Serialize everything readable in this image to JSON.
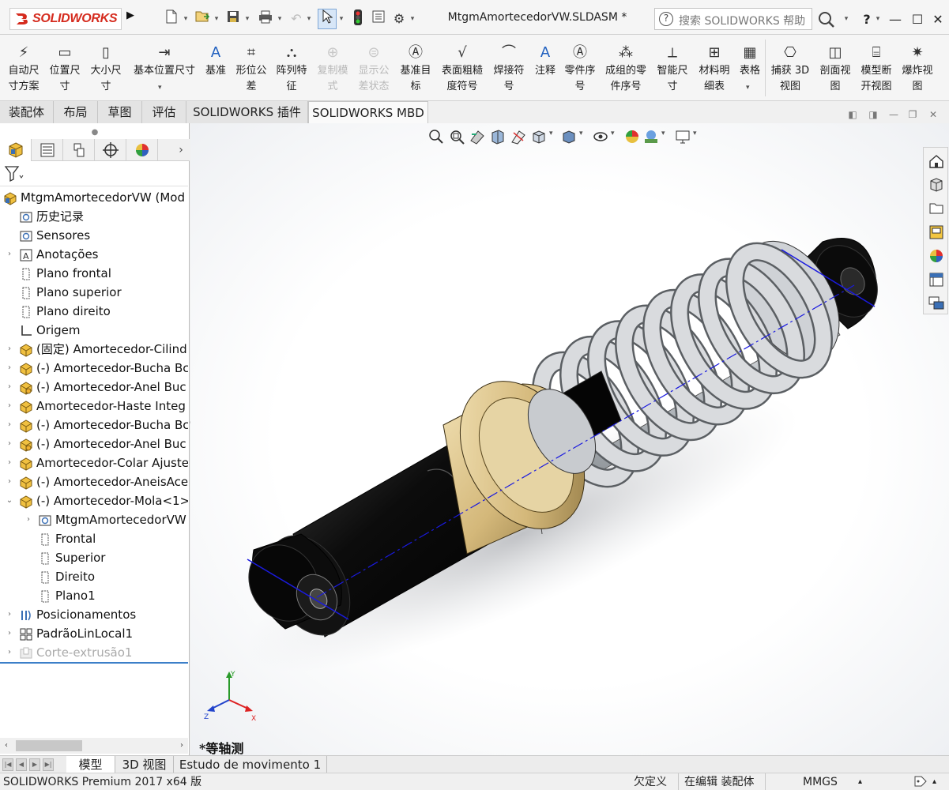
{
  "app": {
    "brand": "SOLIDWORKS",
    "document_title": "MtgmAmortecedorVW.SLDASM *",
    "help_search_placeholder": "搜索 SOLIDWORKS 帮助",
    "help_label": "?"
  },
  "ribbon": {
    "buttons": [
      {
        "label": "自动尺\n寸方案",
        "icon": "auto-dimension-icon"
      },
      {
        "label": "位置尺\n寸",
        "icon": "location-dimension-icon"
      },
      {
        "label": "大小尺\n寸",
        "icon": "size-dimension-icon"
      },
      {
        "label": "基本位置尺寸",
        "icon": "basic-location-dimension-icon"
      },
      {
        "label": "基准",
        "icon": "datum-icon"
      },
      {
        "label": "形位公\n差",
        "icon": "geometric-tolerance-icon"
      },
      {
        "label": "阵列特\n征",
        "icon": "pattern-feature-icon"
      },
      {
        "label": "复制模\n式",
        "icon": "copy-scheme-icon",
        "disabled": true
      },
      {
        "label": "显示公\n差状态",
        "icon": "show-tolerance-status-icon",
        "disabled": true
      },
      {
        "label": "基准目\n标",
        "icon": "datum-target-icon"
      },
      {
        "label": "表面粗糙\n度符号",
        "icon": "surface-finish-icon"
      },
      {
        "label": "焊接符\n号",
        "icon": "weld-symbol-icon"
      },
      {
        "label": "注释",
        "icon": "note-icon"
      },
      {
        "label": "零件序\n号",
        "icon": "balloon-icon"
      },
      {
        "label": "成组的零\n件序号",
        "icon": "stacked-balloon-icon"
      },
      {
        "label": "智能尺\n寸",
        "icon": "smart-dimension-icon"
      },
      {
        "label": "材料明\n细表",
        "icon": "bill-of-materials-icon"
      },
      {
        "label": "表格",
        "icon": "table-icon"
      },
      {
        "label": "捕获 3D\n视图",
        "icon": "capture-3d-view-icon"
      },
      {
        "label": "剖面视\n图",
        "icon": "section-view-icon"
      },
      {
        "label": "模型断\n开视图",
        "icon": "model-break-view-icon"
      },
      {
        "label": "爆炸视\n图",
        "icon": "exploded-view-icon"
      }
    ]
  },
  "command_tabs": [
    "装配体",
    "布局",
    "草图",
    "评估",
    "SOLIDWORKS 插件",
    "SOLIDWORKS MBD"
  ],
  "active_command_tab": "SOLIDWORKS MBD",
  "tree": {
    "rows": [
      {
        "label": "MtgmAmortecedorVW  (Mod",
        "icon": "assembly-icon",
        "indent": 0,
        "expander": ""
      },
      {
        "label": "历史记录",
        "icon": "history-icon",
        "indent": 1,
        "expander": ""
      },
      {
        "label": "Sensores",
        "icon": "sensors-icon",
        "indent": 1,
        "expander": ""
      },
      {
        "label": "Anotações",
        "icon": "annotations-icon",
        "indent": 1,
        "expander": "›"
      },
      {
        "label": "Plano frontal",
        "icon": "plane-icon",
        "indent": 1,
        "expander": ""
      },
      {
        "label": "Plano superior",
        "icon": "plane-icon",
        "indent": 1,
        "expander": ""
      },
      {
        "label": "Plano direito",
        "icon": "plane-icon",
        "indent": 1,
        "expander": ""
      },
      {
        "label": "Origem",
        "icon": "origin-icon",
        "indent": 1,
        "expander": ""
      },
      {
        "label": "(固定) Amortecedor-Cilind",
        "icon": "part-icon",
        "indent": 1,
        "expander": "›"
      },
      {
        "label": "(-) Amortecedor-Bucha Bc",
        "icon": "part-icon",
        "indent": 1,
        "expander": "›"
      },
      {
        "label": "(-) Amortecedor-Anel Buc",
        "icon": "part-hand-icon",
        "indent": 1,
        "expander": "›"
      },
      {
        "label": "Amortecedor-Haste Integ",
        "icon": "part-icon",
        "indent": 1,
        "expander": "›"
      },
      {
        "label": "(-) Amortecedor-Bucha Bc",
        "icon": "part-icon",
        "indent": 1,
        "expander": "›"
      },
      {
        "label": "(-) Amortecedor-Anel Buc",
        "icon": "part-hand-icon",
        "indent": 1,
        "expander": "›"
      },
      {
        "label": "Amortecedor-Colar Ajuste",
        "icon": "part-icon",
        "indent": 1,
        "expander": "›"
      },
      {
        "label": "(-) Amortecedor-AneisAce",
        "icon": "part-icon",
        "indent": 1,
        "expander": "›"
      },
      {
        "label": "(-) Amortecedor-Mola<1>",
        "icon": "part-icon",
        "indent": 1,
        "expander": "⌄"
      },
      {
        "label": "MtgmAmortecedorVW",
        "icon": "history-folder-icon",
        "indent": 2,
        "expander": "›"
      },
      {
        "label": "Frontal",
        "icon": "plane-icon",
        "indent": 2,
        "expander": ""
      },
      {
        "label": "Superior",
        "icon": "plane-icon",
        "indent": 2,
        "expander": ""
      },
      {
        "label": "Direito",
        "icon": "plane-icon",
        "indent": 2,
        "expander": ""
      },
      {
        "label": "Plano1",
        "icon": "plane-icon",
        "indent": 2,
        "expander": ""
      },
      {
        "label": "Posicionamentos",
        "icon": "mates-icon",
        "indent": 1,
        "expander": "›"
      },
      {
        "label": "PadrãoLinLocal1",
        "icon": "linear-pattern-icon",
        "indent": 1,
        "expander": "›"
      },
      {
        "label": "Corte-extrusão1",
        "icon": "cut-extrude-icon",
        "indent": 1,
        "expander": "›",
        "dim": true
      }
    ]
  },
  "viewport": {
    "view_name": "*等轴测",
    "triad_labels": {
      "x": "X",
      "y": "Y",
      "z": "Z"
    }
  },
  "bottom_tabs": [
    "模型",
    "3D 视图",
    "Estudo de movimento 1"
  ],
  "active_bottom_tab": "模型",
  "status": {
    "product": "SOLIDWORKS Premium 2017 x64 版",
    "definition": "欠定义",
    "mode": "在编辑 装配体",
    "units": "MMGS"
  }
}
